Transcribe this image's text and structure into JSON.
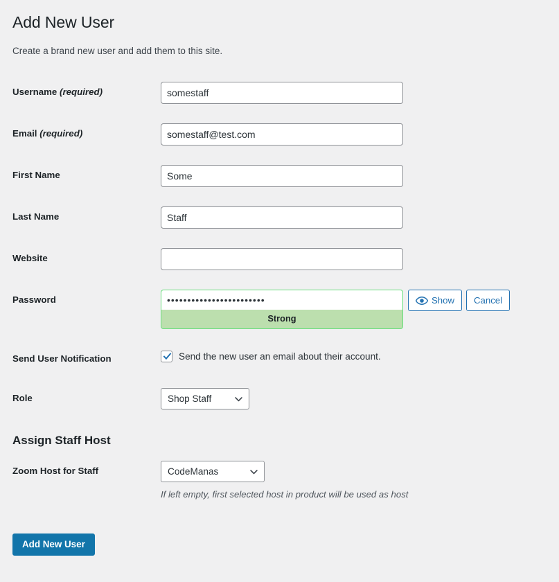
{
  "page": {
    "title": "Add New User",
    "description": "Create a brand new user and add them to this site."
  },
  "colors": {
    "background": "#f0f0f1",
    "primary_button": "#1275aa",
    "link_blue": "#2271b1",
    "input_border": "#8c8f94",
    "strength_strong_bg": "#bcdfae",
    "strength_strong_border": "#68de7c",
    "text": "#1d2327"
  },
  "fields": {
    "username": {
      "label": "Username",
      "required_note": "(required)",
      "value": "somestaff",
      "placeholder": ""
    },
    "email": {
      "label": "Email",
      "required_note": "(required)",
      "value": "somestaff@test.com",
      "placeholder": ""
    },
    "first_name": {
      "label": "First Name",
      "value": "Some",
      "placeholder": ""
    },
    "last_name": {
      "label": "Last Name",
      "value": "Staff",
      "placeholder": ""
    },
    "website": {
      "label": "Website",
      "value": "",
      "placeholder": ""
    },
    "password": {
      "label": "Password",
      "value": "••••••••••••••••••••••••",
      "placeholder": "",
      "strength_label": "Strong",
      "show_button": "Show",
      "cancel_button": "Cancel",
      "show_icon": "eye-icon"
    },
    "send_notification": {
      "label": "Send User Notification",
      "checkbox_label": "Send the new user an email about their account.",
      "checked": true
    },
    "role": {
      "label": "Role",
      "selected": "Shop Staff",
      "options": [
        "Shop Staff"
      ],
      "chevron_icon": "chevron-down-icon"
    }
  },
  "assign_staff_host": {
    "heading": "Assign Staff Host",
    "host_field": {
      "label": "Zoom Host for Staff",
      "selected": "CodeManas",
      "options": [
        "CodeManas"
      ],
      "chevron_icon": "chevron-down-icon",
      "help_text": "If left empty, first selected host in product will be used as host"
    }
  },
  "submit": {
    "label": "Add New User"
  }
}
